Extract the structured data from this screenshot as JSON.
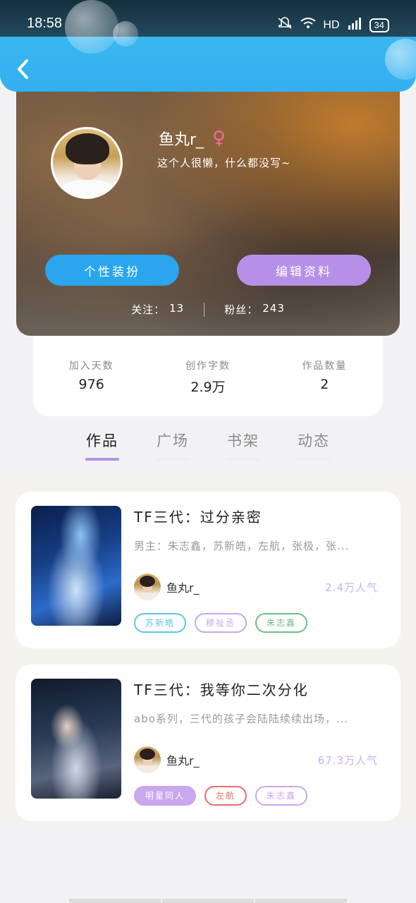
{
  "status_bar": {
    "time": "18:58",
    "network": "HD",
    "signal": "4G",
    "battery": "34"
  },
  "header": {
    "back_icon": "chevron-left-icon"
  },
  "profile": {
    "name": "鱼丸r_",
    "gender_symbol": "♀",
    "bio": "这个人很懒，什么都没写~",
    "decorate_label": "个性装扮",
    "edit_label": "编辑资料",
    "follow_label": "关注：",
    "follow_count": "13",
    "fans_label": "粉丝：",
    "fans_count": "243",
    "colors": {
      "decorate_button": "#2aa6ee",
      "edit_button": "#b690e6",
      "gender": "#f06a9a"
    }
  },
  "stats": [
    {
      "label": "加入天数",
      "value": "976"
    },
    {
      "label": "创作字数",
      "value": "2.9万"
    },
    {
      "label": "作品数量",
      "value": "2"
    }
  ],
  "tabs": [
    {
      "label": "作品",
      "active": true
    },
    {
      "label": "广场",
      "active": false
    },
    {
      "label": "书架",
      "active": false
    },
    {
      "label": "动态",
      "active": false
    }
  ],
  "works": [
    {
      "title": "TF三代：过分亲密",
      "description": "男主：朱志鑫，苏新皓，左航，张极，张...",
      "author": "鱼丸r_",
      "popularity": "2.4万人气",
      "tags": [
        "苏新皓",
        "穆祉丞",
        "朱志鑫"
      ]
    },
    {
      "title": "TF三代：我等你二次分化",
      "description": "abo系列，三代的孩子会陆陆续续出场，...",
      "author": "鱼丸r_",
      "popularity": "67.3万人气",
      "tags": [
        "明星同人",
        "左航",
        "朱志鑫"
      ]
    }
  ]
}
